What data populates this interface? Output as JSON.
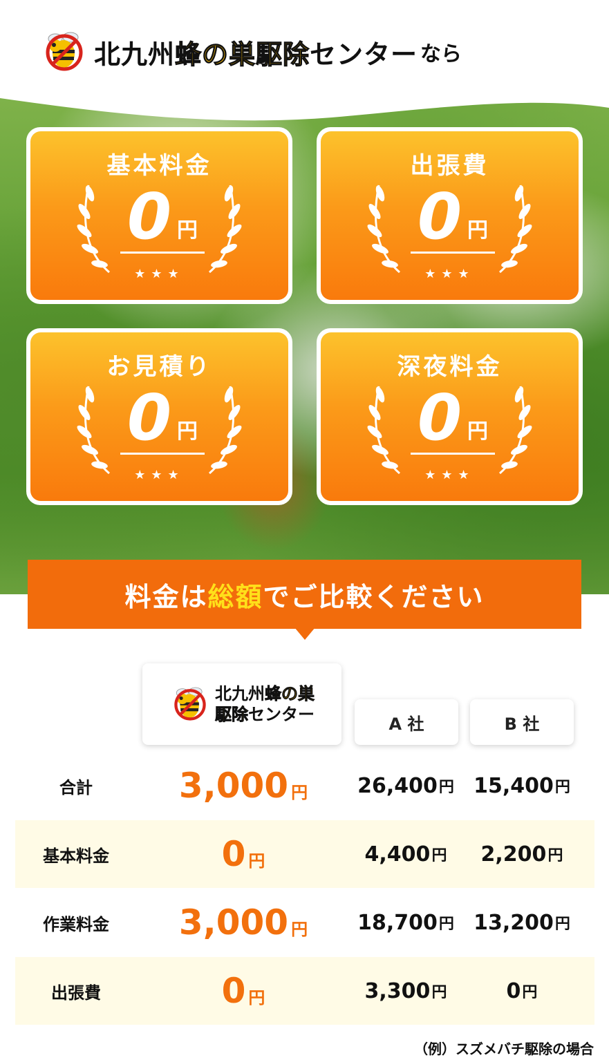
{
  "header": {
    "title_part1": "北九州",
    "title_accent": "蜂の巣駆除",
    "title_part2": "センター",
    "title_suffix": "なら"
  },
  "cards": [
    {
      "label": "基本料金",
      "value": "0",
      "unit": "円",
      "stars": "★★★"
    },
    {
      "label": "出張費",
      "value": "0",
      "unit": "円",
      "stars": "★★★"
    },
    {
      "label": "お見積り",
      "value": "0",
      "unit": "円",
      "stars": "★★★"
    },
    {
      "label": "深夜料金",
      "value": "0",
      "unit": "円",
      "stars": "★★★"
    }
  ],
  "banner": {
    "text_before": "料金は",
    "text_accent": "総額",
    "text_after": "でご比較ください"
  },
  "table": {
    "ours_logo": {
      "line1_part1": "北九州",
      "line1_accent": "蜂の巣",
      "line2_accent": "駆除",
      "line2_part2": "センター"
    },
    "company_a": "A 社",
    "company_b": "B 社",
    "rows": [
      {
        "label": "合計",
        "ours": "3,000",
        "a": "26,400",
        "b": "15,400"
      },
      {
        "label": "基本料金",
        "ours": "0",
        "a": "4,400",
        "b": "2,200"
      },
      {
        "label": "作業料金",
        "ours": "3,000",
        "a": "18,700",
        "b": "13,200"
      },
      {
        "label": "出張費",
        "ours": "0",
        "a": "3,300",
        "b": "0"
      }
    ],
    "unit": "円"
  },
  "footnote": "（例）スズメバチ駆除の場合",
  "colors": {
    "orange": "#f26c0c",
    "card_top": "#fcc22c",
    "card_bottom": "#f97a0c",
    "accent_yellow": "#f5b800",
    "row_shade": "#fffbe6"
  }
}
